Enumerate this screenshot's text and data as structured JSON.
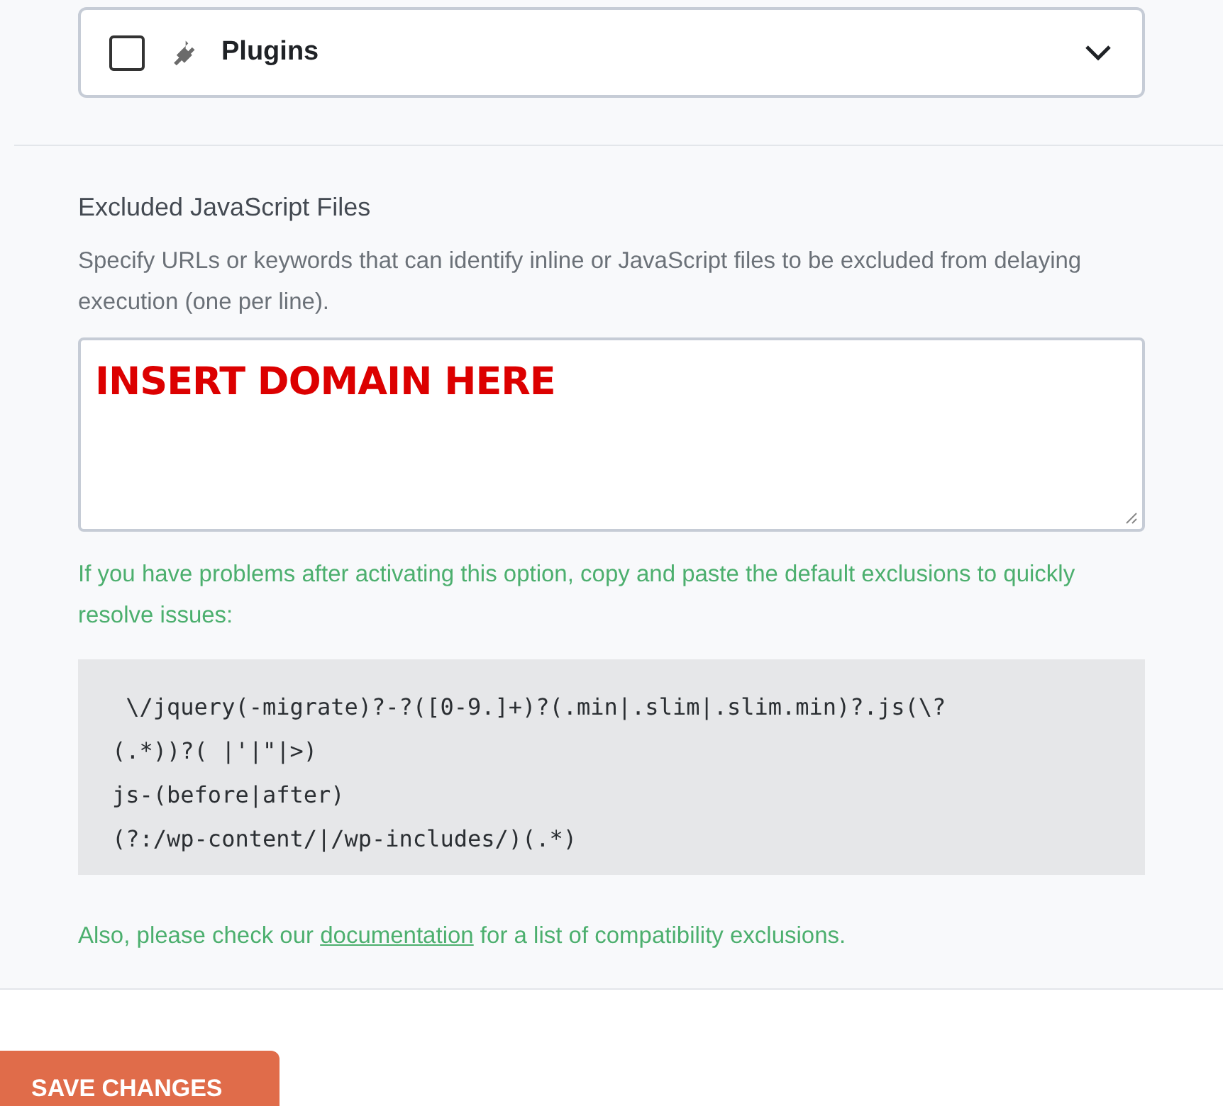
{
  "plugins_row": {
    "label": "Plugins",
    "checked": false,
    "expanded": false
  },
  "excluded_js": {
    "title": "Excluded JavaScript Files",
    "description": "Specify URLs or keywords that can identify inline or JavaScript files to be excluded from delaying execution (one per line).",
    "value": "INSERT DOMAIN HERE",
    "hint": "If you have problems after activating this option, copy and paste the default exclusions to quickly resolve issues:",
    "code_lines": [
      " \\/jquery(-migrate)?-?([0-9.]+)?(.min|.slim|.slim.min)?.js(\\?",
      "(.*))?( |'|\"|>)",
      "js-(before|after)",
      "(?:/wp-content/|/wp-includes/)(.*)"
    ],
    "note": {
      "before": "Also, please check our",
      "link": "documentation",
      "after": "for a list of compatibility exclusions."
    }
  },
  "save_button": "SAVE CHANGES"
}
